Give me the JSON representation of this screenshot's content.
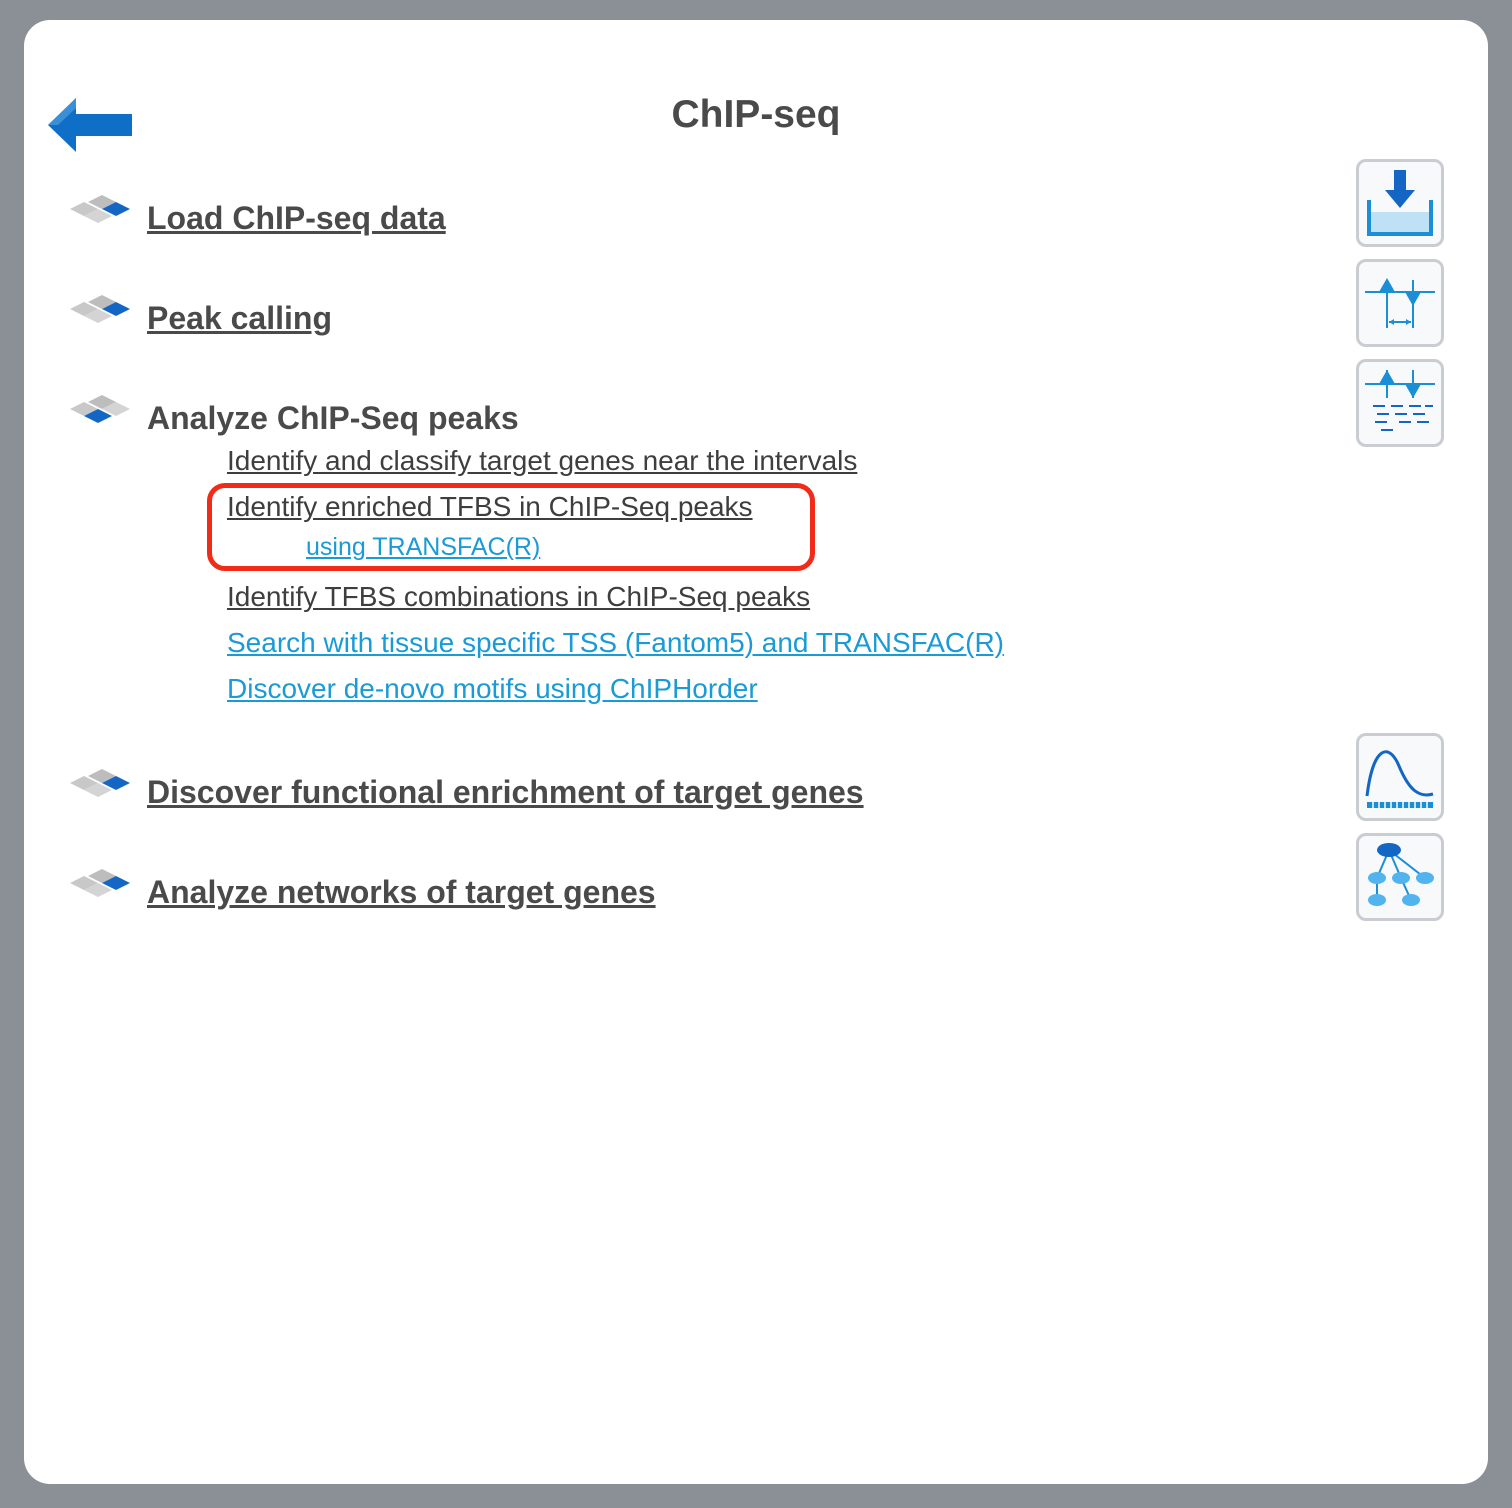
{
  "page": {
    "title": "ChIP-seq"
  },
  "sections": [
    {
      "label": "Load ChIP-seq data"
    },
    {
      "label": "Peak calling"
    },
    {
      "label": "Analyze ChIP-Seq peaks"
    },
    {
      "label": "Discover functional enrichment of target genes"
    },
    {
      "label": "Analyze networks of target genes"
    }
  ],
  "analyze_links": [
    {
      "label": "Identify and classify target genes near the intervals"
    },
    {
      "label": "Identify enriched TFBS in ChIP-Seq peaks"
    },
    {
      "label": "using TRANSFAC(R)"
    },
    {
      "label": "Identify TFBS combinations in ChIP-Seq peaks"
    },
    {
      "label": "Search with tissue specific TSS (Fantom5) and TRANSFAC(R)"
    },
    {
      "label": "Discover de-novo motifs using ChIPHorder"
    }
  ],
  "icons": {
    "back": "back-arrow-icon",
    "section": "stacked-squares-icon",
    "tools": [
      "import-icon",
      "peak-calling-icon",
      "peak-analysis-icon",
      "enrichment-curve-icon",
      "network-icon"
    ]
  },
  "colors": {
    "frame": "#8b9097",
    "accent_blue": "#1a9ad6",
    "icon_blue": "#0f6fc6",
    "text_dark": "#4a4a4a",
    "highlight_red": "#f02b17"
  }
}
